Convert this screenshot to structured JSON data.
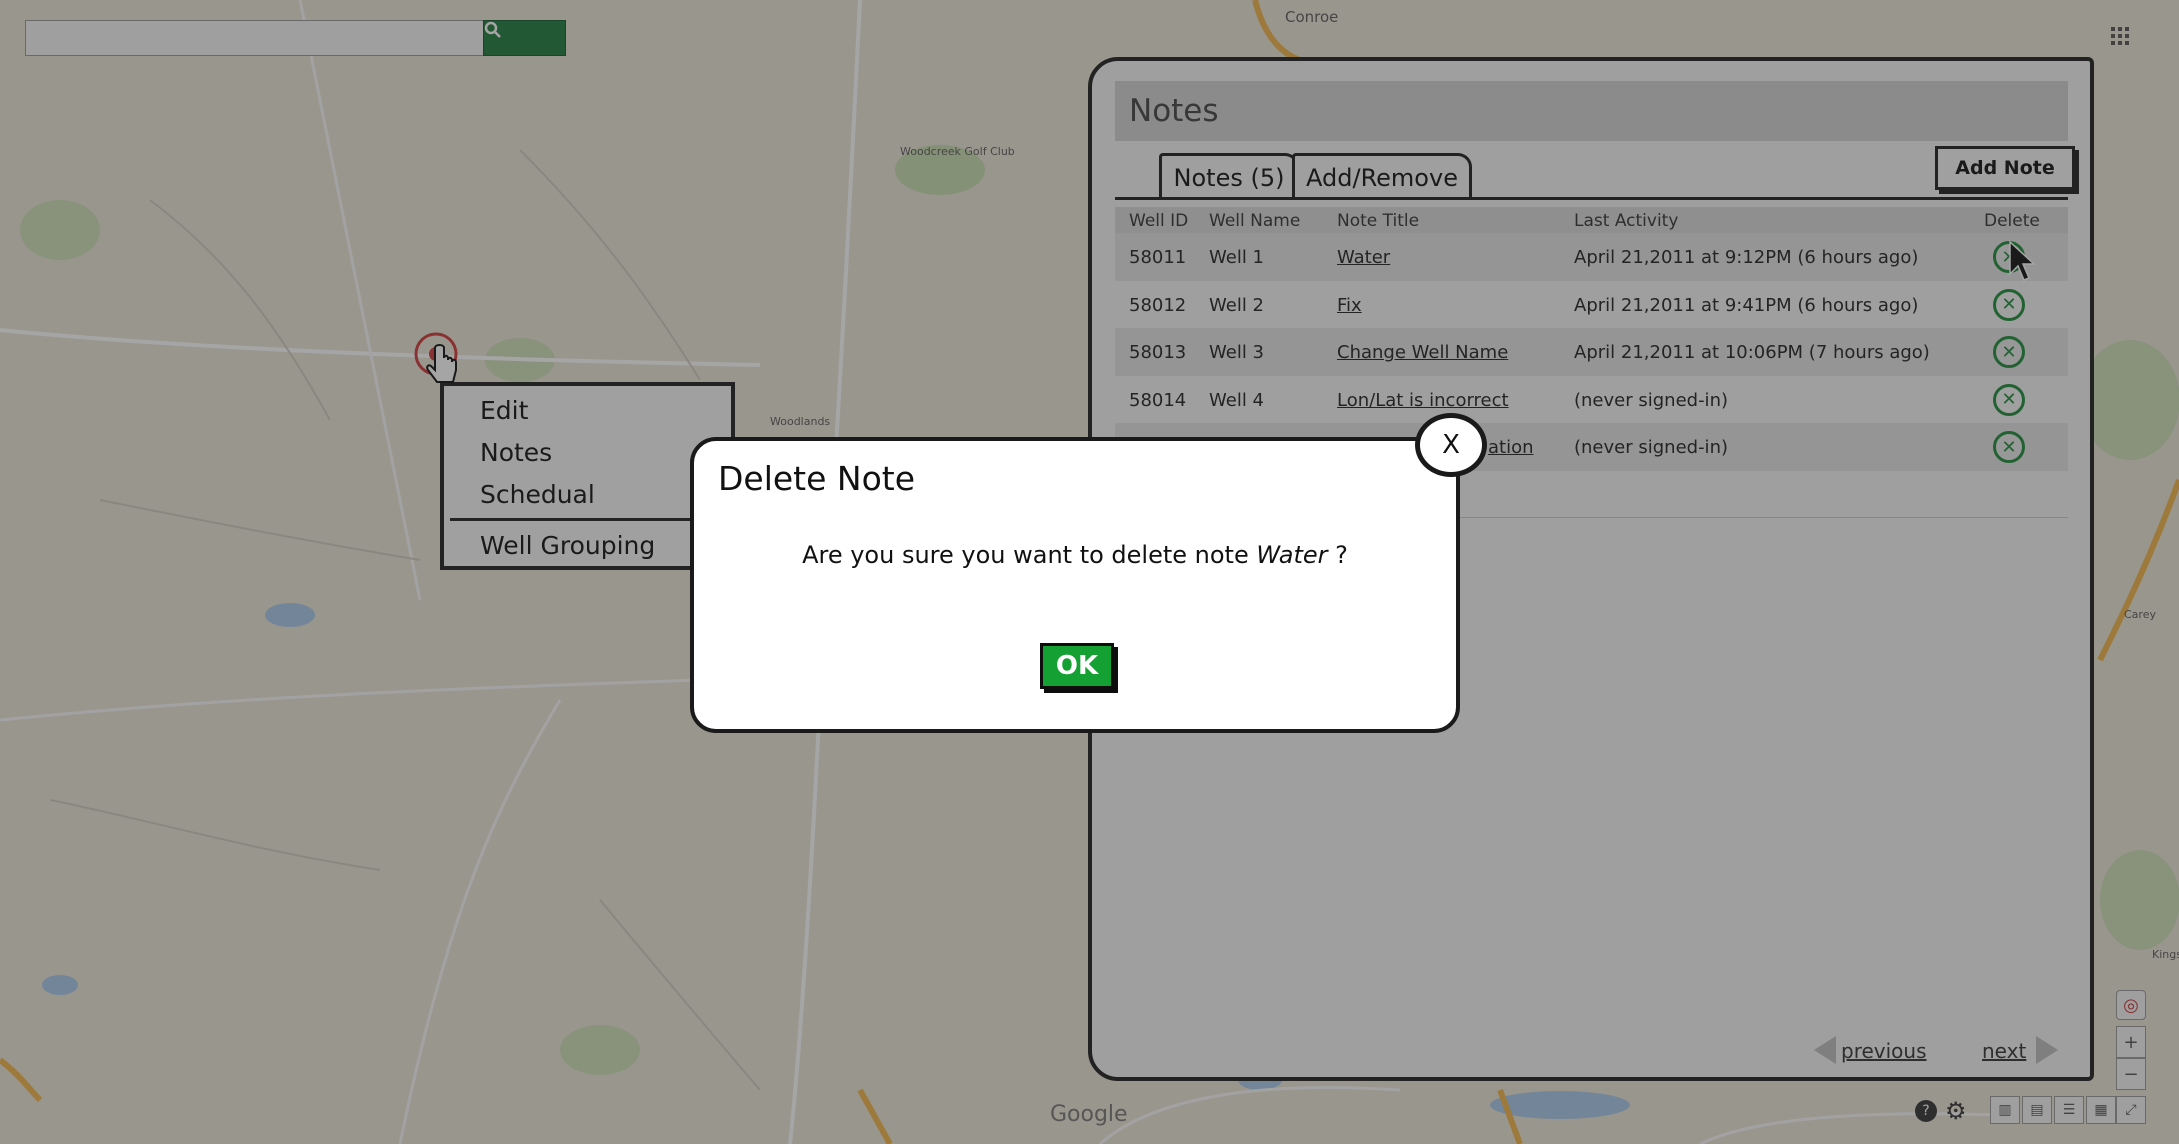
{
  "map": {
    "labels": [
      "Conroe",
      "Woodcreek Golf Club",
      "Woodlands",
      "Google",
      "Kings",
      "Carey"
    ],
    "controls": {
      "zoom_in": "+",
      "zoom_out": "−",
      "fullscreen": "⤢"
    }
  },
  "context_menu": {
    "items": [
      "Edit",
      "Notes",
      "Schedual",
      "Well Grouping"
    ]
  },
  "notes_panel": {
    "title": "Notes",
    "tabs": [
      "Notes (5)",
      "Add/Remove"
    ],
    "add_note_label": "Add Note",
    "columns": [
      "Well ID",
      "Well Name",
      "Note Title",
      "Last Activity",
      "Delete"
    ],
    "rows": [
      {
        "well_id": "58011",
        "well_name": "Well 1",
        "note_title": "Water",
        "last_activity": "April 21,2011 at 9:12PM (6 hours ago)"
      },
      {
        "well_id": "58012",
        "well_name": "Well 2",
        "note_title": "Fix",
        "last_activity": "April 21,2011 at 9:41PM (6 hours ago)"
      },
      {
        "well_id": "58013",
        "well_name": "Well 3",
        "note_title": "Change Well Name",
        "last_activity": "April 21,2011 at 10:06PM (7 hours ago)"
      },
      {
        "well_id": "58014",
        "well_name": "Well 4",
        "note_title": "Lon/Lat is incorrect",
        "last_activity": "(never signed-in)"
      },
      {
        "well_id": "",
        "well_name": "",
        "note_title": "ation",
        "last_activity": "(never signed-in)"
      }
    ],
    "pager": {
      "previous": "previous",
      "next": "next"
    }
  },
  "dialog": {
    "title": "Delete Note",
    "message_prefix": "Are you sure you want to delete note ",
    "note_name": "Water",
    "message_suffix": " ?",
    "ok_label": "OK",
    "close_label": "X"
  },
  "colors": {
    "accent_green": "#14a032",
    "map_search_green": "#1e7b3c"
  }
}
